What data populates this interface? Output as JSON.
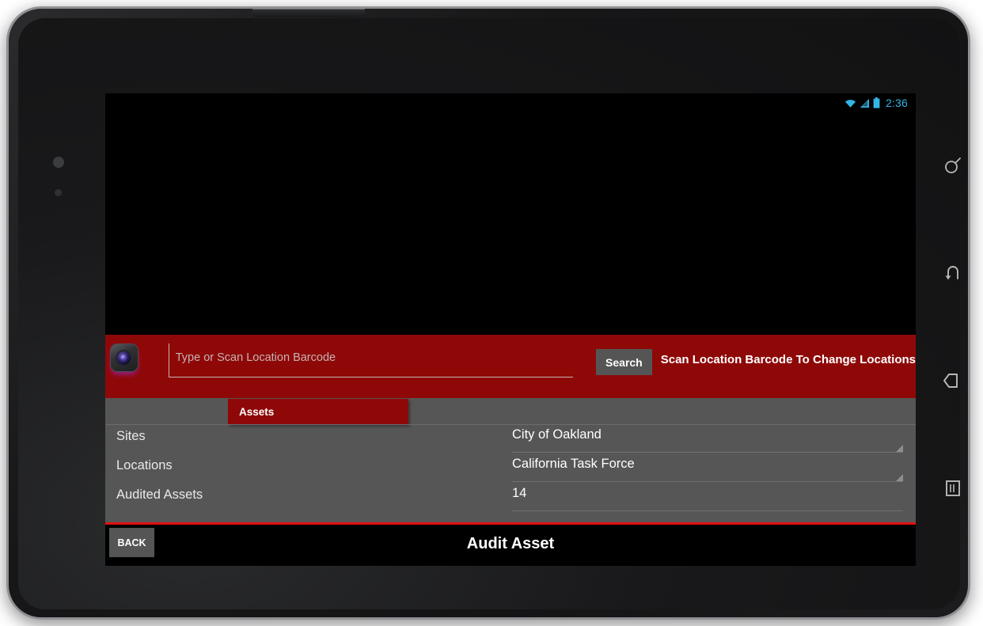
{
  "device": {
    "type": "android-tablet",
    "orientation": "landscape",
    "nav_keys": [
      {
        "name": "search-key",
        "icon": "magnifier-icon"
      },
      {
        "name": "back-key",
        "icon": "curved-back-arrow-icon"
      },
      {
        "name": "home-key",
        "icon": "home-pentagon-icon"
      },
      {
        "name": "recents-key",
        "icon": "recent-apps-icon"
      }
    ]
  },
  "status_bar": {
    "clock": "2:36",
    "icons": [
      "wifi-icon",
      "signal-icon",
      "battery-icon"
    ],
    "accent_color": "#33b5e5"
  },
  "scan_bar": {
    "background_color": "#8f0808",
    "camera_button_name": "scan-barcode-camera-button",
    "input": {
      "value": "",
      "placeholder": "Type or Scan Location Barcode"
    },
    "search_label": "Search",
    "hint": "Scan Location Barcode To Change Locations"
  },
  "details": {
    "background_color": "#565656",
    "tabs": [
      {
        "label": "Assets",
        "selected": true
      }
    ],
    "fields": [
      {
        "label": "Sites",
        "value": "City of Oakland",
        "control": "spinner"
      },
      {
        "label": "Locations",
        "value": "California Task Force",
        "control": "spinner"
      },
      {
        "label": "Audited Assets",
        "value": "14",
        "control": "text"
      }
    ]
  },
  "bottom_bar": {
    "divider_color": "#e01010",
    "back_label": "BACK",
    "title": "Audit Asset"
  }
}
